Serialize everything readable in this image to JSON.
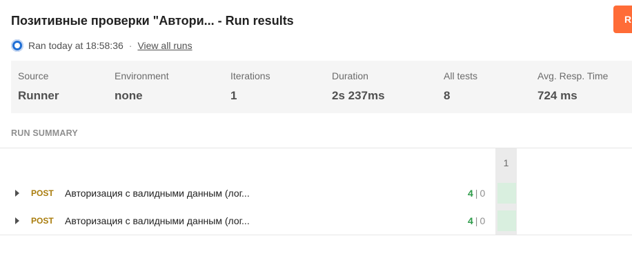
{
  "header": {
    "title": "Позитивные проверки \"Автори... - Run results",
    "top_button_label": "R",
    "ran_text": "Ran today at 18:58:36",
    "separator": "·",
    "view_all_label": "View all runs"
  },
  "stats": [
    {
      "label": "Source",
      "value": "Runner"
    },
    {
      "label": "Environment",
      "value": "none"
    },
    {
      "label": "Iterations",
      "value": "1"
    },
    {
      "label": "Duration",
      "value": "2s 237ms"
    },
    {
      "label": "All tests",
      "value": "8"
    },
    {
      "label": "Avg. Resp. Time",
      "value": "724 ms"
    }
  ],
  "summary": {
    "title": "RUN SUMMARY",
    "iteration_header": "1",
    "requests": [
      {
        "method": "POST",
        "name": "Авторизация с валидными данным (лог...",
        "passed": "4",
        "sep": "|",
        "failed": "0"
      },
      {
        "method": "POST",
        "name": "Авторизация с валидными данным (лог...",
        "passed": "4",
        "sep": "|",
        "failed": "0"
      }
    ]
  },
  "colors": {
    "accent": "#ff6c37",
    "method_post": "#a97c0c",
    "pass": "#2c9a48",
    "pass_cell": "#d9efdf"
  }
}
